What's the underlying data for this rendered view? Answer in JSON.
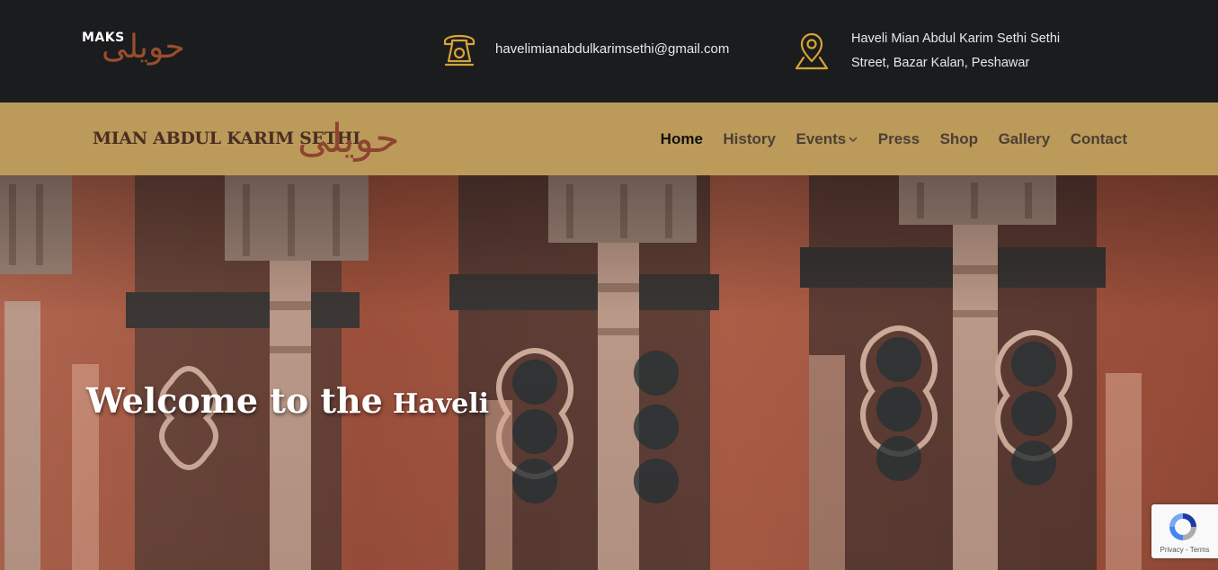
{
  "topbar": {
    "logo_latin": "MAKS",
    "logo_urdu": "حویلی",
    "email": "havelimianabdulkarimsethi@gmail.com",
    "address": "Haveli Mian Abdul Karim Sethi Sethi Street, Bazar Kalan, Peshawar",
    "email_icon": "telephone-icon",
    "address_icon": "map-pin-icon",
    "icon_color": "#d6a437"
  },
  "navbar": {
    "logo_english": "MIAN ABDUL KARIM SETHI",
    "logo_urdu": "حویلی",
    "background": "#bc9a59",
    "menu": [
      {
        "label": "Home",
        "active": true
      },
      {
        "label": "History"
      },
      {
        "label": "Events",
        "has_dropdown": true
      },
      {
        "label": "Press"
      },
      {
        "label": "Shop"
      },
      {
        "label": "Gallery"
      },
      {
        "label": "Contact"
      }
    ]
  },
  "hero": {
    "title_part1": "Welcome to the",
    "title_part2": "Haveli"
  },
  "recaptcha": {
    "footer": "Privacy - Terms"
  }
}
